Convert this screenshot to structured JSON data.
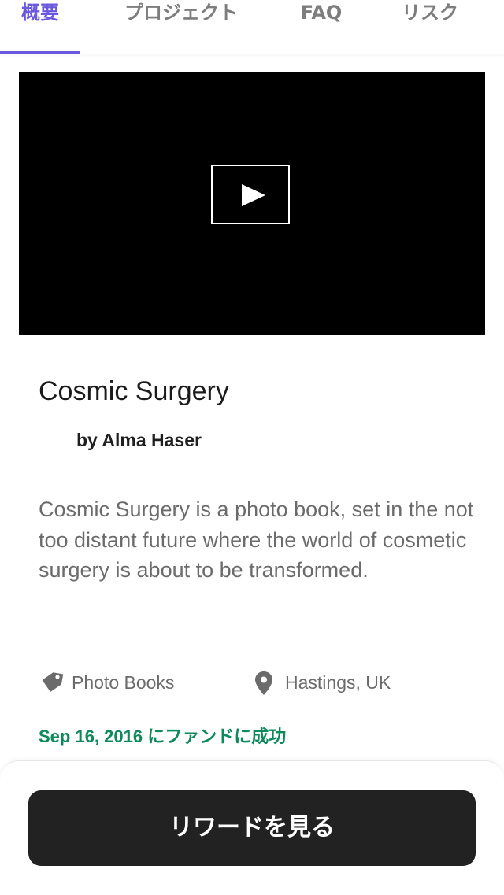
{
  "tabs": [
    {
      "label": "概要",
      "active": true
    },
    {
      "label": "プロジェクト",
      "active": false
    },
    {
      "label": "FAQ",
      "active": false
    },
    {
      "label": "リスク",
      "active": false
    }
  ],
  "video": {
    "play_icon": "play-icon"
  },
  "project": {
    "title": "Cosmic Surgery",
    "byline": "by Alma Haser",
    "description": "Cosmic Surgery is a photo book, set in the not too distant future where the world of cosmetic surgery is about to be transformed.",
    "category": "Photo Books",
    "category_icon": "tag-icon",
    "location": "Hastings, UK",
    "location_icon": "location-pin-icon",
    "funded_status": "Sep 16, 2016 にファンドに成功"
  },
  "cta": {
    "label": "リワードを見る"
  },
  "colors": {
    "accent": "#6a58df",
    "success": "#0e8a5a",
    "button_bg": "#222222"
  }
}
